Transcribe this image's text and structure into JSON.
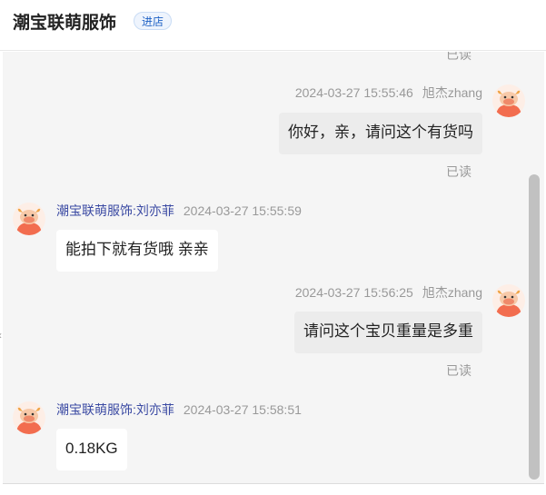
{
  "header": {
    "shop_name": "潮宝联萌服饰",
    "enter_label": "进店"
  },
  "messages": [
    {
      "side": "right",
      "read": "已读"
    },
    {
      "side": "right",
      "time": "2024-03-27 15:55:46",
      "sender": "旭杰zhang",
      "text": "你好，亲，请问这个有货吗",
      "read": "已读"
    },
    {
      "side": "left",
      "time": "2024-03-27 15:55:59",
      "sender": "潮宝联萌服饰:刘亦菲",
      "text": "能拍下就有货哦 亲亲"
    },
    {
      "side": "right",
      "time": "2024-03-27 15:56:25",
      "sender": "旭杰zhang",
      "text": "请问这个宝贝重量是多重",
      "read": "已读"
    },
    {
      "side": "left",
      "time": "2024-03-27 15:58:51",
      "sender": "潮宝联萌服饰:刘亦菲",
      "text": "0.18KG"
    }
  ],
  "icons": {
    "avatar": "cow-avatar-icon",
    "scroll_left": "chevron-left-icon"
  },
  "colors": {
    "chat_bg": "#f5f5f5",
    "sender_left": "#3b4aa3",
    "enter_btn_text": "#1f62c5"
  }
}
